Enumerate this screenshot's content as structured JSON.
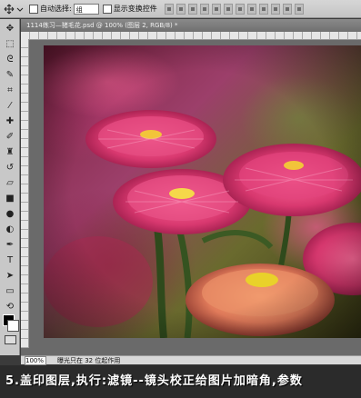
{
  "options_bar": {
    "auto_select_label": "自动选择:",
    "auto_select_value": "组",
    "show_transform_label": "显示变换控件"
  },
  "document": {
    "tab_title": "1114练习—猪毛花.psd @ 100% (图层 2, RGB/8) *",
    "zoom": "100%",
    "status_text": "曝光只在 32 位起作用"
  },
  "caption": {
    "text": "5.盖印图层,执行:滤镜--镜头校正给图片加暗角,参数"
  },
  "tools": [
    "move-tool",
    "marquee-tool",
    "lasso-tool",
    "quick-select-tool",
    "crop-tool",
    "eyedropper-tool",
    "healing-brush-tool",
    "brush-tool",
    "clone-stamp-tool",
    "history-brush-tool",
    "eraser-tool",
    "gradient-tool",
    "blur-tool",
    "dodge-tool",
    "pen-tool",
    "type-tool",
    "path-select-tool",
    "shape-tool",
    "3d-rotate-tool",
    "3d-orbit-tool",
    "hand-tool",
    "zoom-tool"
  ],
  "colors": {
    "foreground": "#000000",
    "background": "#ffffff",
    "flower_pink": "#d8386f",
    "flower_center": "#e9d12a"
  }
}
